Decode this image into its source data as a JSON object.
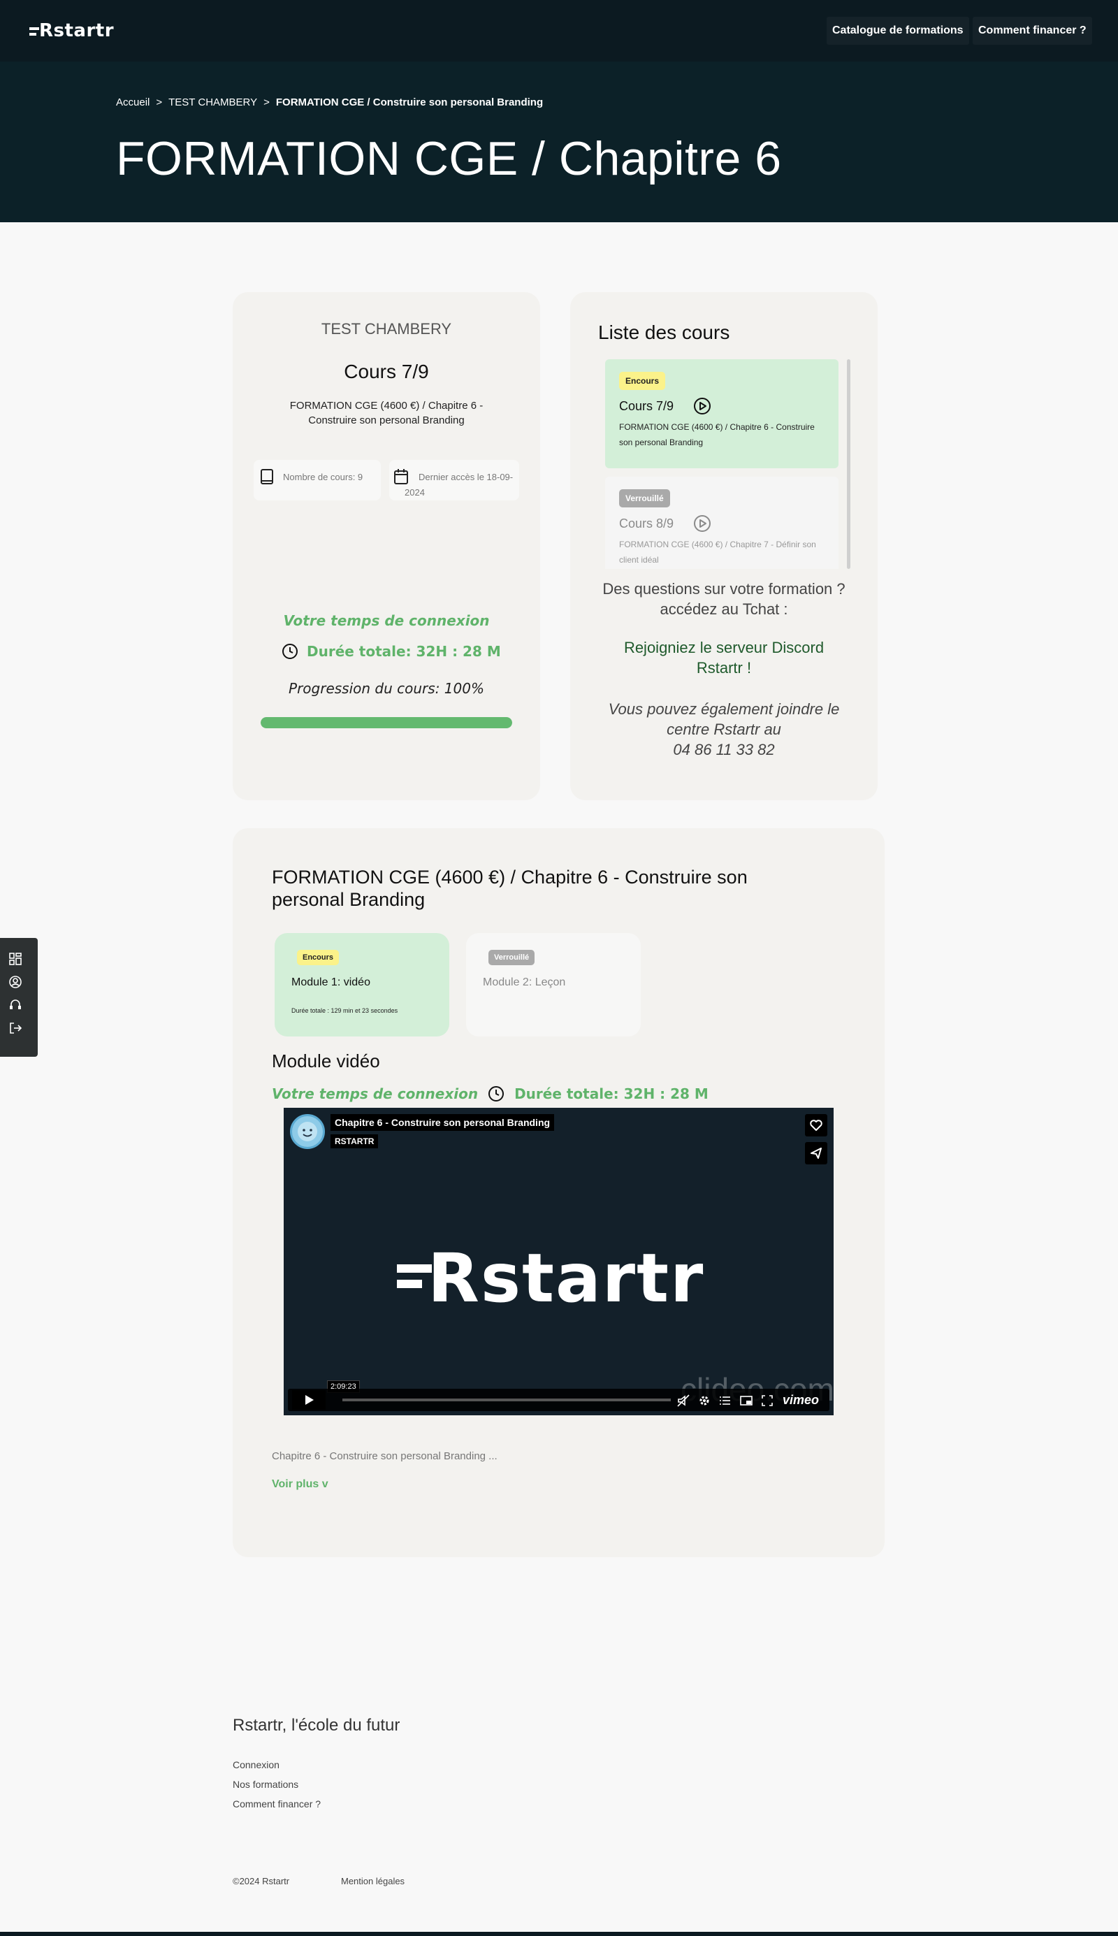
{
  "nav": {
    "logo": "Rstartr",
    "catalogue": "Catalogue de formations",
    "financer": "Comment financer ?"
  },
  "breadcrumb": {
    "home": "Accueil",
    "sep": ">",
    "section": "TEST CHAMBERY",
    "current": "FORMATION CGE / Construire son personal Branding"
  },
  "page_title": "FORMATION CGE / Chapitre 6",
  "course_card": {
    "school": "TEST CHAMBERY",
    "count": "Cours 7/9",
    "description": "FORMATION CGE (4600 €) / Chapitre 6 - Construire son personal Branding",
    "courses_count": "Nombre de cours: 9",
    "last_access": "Dernier accès le 18-09-2024",
    "connection_title": "Votre temps de connexion",
    "duration": "Durée totale: 32H : 28 M",
    "progress_text": "Progression du cours: 100%",
    "progress_value": 1.0
  },
  "course_list": {
    "title": "Liste des cours",
    "items": [
      {
        "badge": "Encours",
        "label": "Cours 7/9",
        "desc": "FORMATION CGE (4600 €) / Chapitre 6 - Construire son personal Branding"
      },
      {
        "badge": "Verrouillé",
        "label": "Cours 8/9",
        "desc": "FORMATION CGE (4600 €) / Chapitre 7 - Définir son client idéal"
      }
    ],
    "questions": "Des questions sur votre formation ? accédez au Tchat :",
    "discord": "Rejoigniez le serveur Discord Rstartr !",
    "phone_line1": "Vous pouvez également joindre le centre Rstartr au",
    "phone_line2": "04 86 11 33 82"
  },
  "module": {
    "title": "FORMATION CGE (4600 €) / Chapitre 6 - Construire son personal Branding",
    "modules": [
      {
        "badge": "Encours",
        "label": "Module 1: vidéo",
        "duration": "Durée totale : 129 min et 23 secondes"
      },
      {
        "badge": "Verrouillé",
        "label": "Module 2: Leçon"
      }
    ],
    "subtitle": "Module vidéo",
    "connection_title": "Votre temps de connexion",
    "duration": "Durée totale: 32H : 28 M",
    "video": {
      "title": "Chapitre 6 - Construire son personal Branding",
      "author": "RSTARTR",
      "logo": "Rstartr",
      "watermark": "clideo.com",
      "time": "2:09:23",
      "provider": "vimeo"
    },
    "description": "Chapitre 6 - Construire son personal Branding ...",
    "see_more": "Voir plus v"
  },
  "footer": {
    "title": "Rstartr, l'école du futur",
    "links": [
      "Connexion",
      "Nos formations",
      "Comment financer ?"
    ],
    "copyright": "©2024 Rstartr",
    "legal": "Mention légales"
  },
  "colors": {
    "header_bg": "#0c1a21",
    "hero_bg": "#0c2128",
    "accent_green": "#5fb36a",
    "active_bg": "#d3efd8",
    "badge_yellow": "#fbf28a"
  }
}
